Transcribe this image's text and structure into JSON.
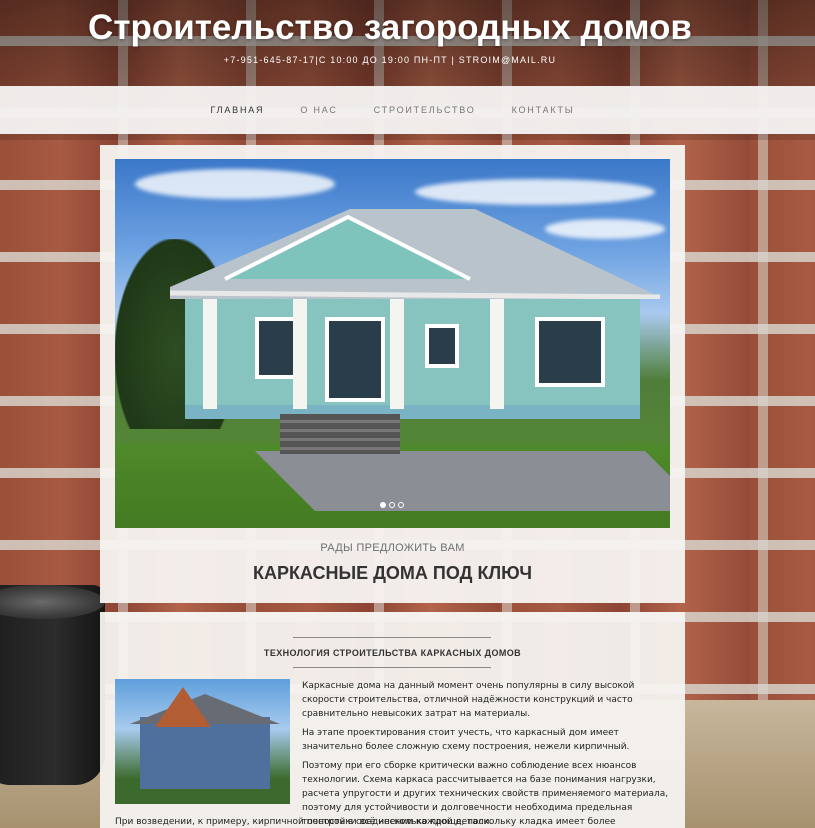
{
  "header": {
    "title": "Строительство загородных домов",
    "contacts": "+7-951-645-87-17|С 10:00 ДО 19:00 ПН-ПТ | STROIM@MAIL.RU"
  },
  "nav": {
    "items": [
      "ГЛАВНАЯ",
      "О НАС",
      "СТРОИТЕЛЬСТВО",
      "КОНТАКТЫ"
    ]
  },
  "hero": {
    "subtitle": "РАДЫ ПРЕДЛОЖИТЬ ВАМ",
    "title": "КАРКАСНЫЕ ДОМА ПОД КЛЮЧ",
    "slides_count": 3,
    "active_slide": 1
  },
  "article": {
    "title": "ТЕХНОЛОГИЯ СТРОИТЕЛЬСТВА КАРКАСНЫХ ДОМОВ",
    "paragraphs": [
      "Каркасные дома на данный момент очень популярны в силу высокой скорости строительства, отличной надёжности конструкций и часто сравнительно невысоких затрат на материалы.",
      "На этапе проектирования стоит учесть, что каркасный дом имеет значительно более сложную схему построения, нежели кирпичный.",
      "Поэтому при его сборке критически важно соблюдение всех нюансов технологии. Схема каркаса рассчитывается на базе понимания нагрузки, расчета упругости и других технических свойств применяемого материала, поэтому для устойчивости и долговечности необходима предельная точность в соединении каждой детали."
    ],
    "continuation": "При возведении, к примеру, кирпичной постройки всё несколько проще, поскольку кладка имеет более примитивное"
  },
  "colors": {
    "brick": "#a85a42",
    "panel": "#f6f3f0",
    "nav_bg": "#f5f3f1",
    "text_dark": "#333333"
  }
}
